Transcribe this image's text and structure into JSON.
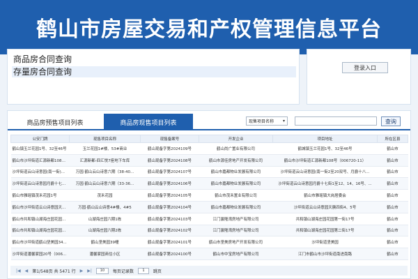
{
  "banner": {
    "title": "鹤山市房屋交易和产权管理信息平台"
  },
  "query_panel": {
    "items": [
      "商品房合同查询",
      "存量房合同查询"
    ]
  },
  "login": {
    "label": "登录入口"
  },
  "list": {
    "tabs": [
      "商品房预售项目列表",
      "商品房现售项目列表"
    ],
    "active_tab": 1,
    "search_select": "现售项目名称",
    "search_button": "查询",
    "columns": [
      "公安门牌",
      "现售项目名称",
      "现售备案号",
      "开发企业",
      "项目地址",
      "所在区县"
    ],
    "rows": [
      [
        "鹤山镇玉兰花园1号、32至46号",
        "玉兰花园1#楼、53#商业",
        "鹤山现备字第2024109号",
        "鹤山尚广置业有限公司",
        "鹤城镇玉兰花园1号、32至46号",
        "鹤山市"
      ],
      [
        "鹤山市沙坪街道汇源新都108号...",
        "汇源新都-四汇悦7座地下车库",
        "鹤山现备字第2024108号",
        "鹤山市源佳房地产开发有限公司",
        "鹤山市沙坪街道汇源新都108号（006720-11）",
        "鹤山市"
      ],
      [
        "沙坪街道云山诗意园(南一街)...",
        "万园·鹤山云山诗意六期（38-40...",
        "鹤山现备字第2024107号",
        "鹤山市嘉都物业发展有限公司",
        "沙坪街道云山诗意园(南一街2至20双号、月爵十八...",
        "鹤山市"
      ],
      [
        "沙坪街道云山诗意园月爵十七...",
        "万园·鹤山云山诗意六期（33-36...",
        "鹤山现备字第2024106号",
        "鹤山市嘉都物业发展有限公司",
        "沙坪街道云山诗意园月爵十七街1至12、14、16号、...",
        "鹤山市"
      ],
      [
        "鹤山市雅瑶镇茂禾花园1号",
        "茂禾花园",
        "鹤山现备字第2024105号",
        "鹤山市茂禾置业有限公司",
        "鹤山市雅瑶镇大岗居委会",
        "鹤山市"
      ],
      [
        "鹤山市沙坪街道云山诗意园天...",
        "万园·鹤山云山诗意4#楼、4#5",
        "鹤山现备字第2024104号",
        "鹤山市嘉都物业发展有限公司",
        "沙坪街道云山诗意园天簇四街4、5号",
        "鹤山市"
      ],
      [
        "鹤山市共和镇山湖海庄园花园...",
        "山湖海庄园六期1栋",
        "鹤山现备字第2024103号",
        "江门骏隆湾房地产有限公司",
        "共和镇山湖海庄园花园第一街17号",
        "鹤山市"
      ],
      [
        "鹤山市共和镇山湖海庄园花园...",
        "山湖海庄园六期2栋",
        "鹤山现备字第2024102号",
        "江门骏隆湾房地产有限公司",
        "共和镇山湖海庄园花园第二街17号",
        "鹤山市"
      ],
      [
        "鹤山市沙坪街道鹤山坚美园34...",
        "鹤山坚美园39幢",
        "鹤山现备字第2024101号",
        "鹤山市坚美房地产开发有限公司",
        "沙坪街道坚美园",
        "鹤山市"
      ],
      [
        "沙坪街道潘馨家园20号（006...",
        "潘馨家园商住小区",
        "鹤山现备字第2024100号",
        "鹤山市中宝房地产有限公司",
        "江门市鹤山市沙坪街道南进南路",
        "鹤山市"
      ]
    ],
    "pager": {
      "page_prefix": "第",
      "page_current": "1",
      "page_middle": "/548页 共",
      "page_total": "5471",
      "page_suffix": "行",
      "per_page": "10",
      "per_page_label": "每页记录数",
      "goto": "1",
      "goto_label": "跳页"
    }
  },
  "colors": {
    "brand": "#1f5fae"
  }
}
